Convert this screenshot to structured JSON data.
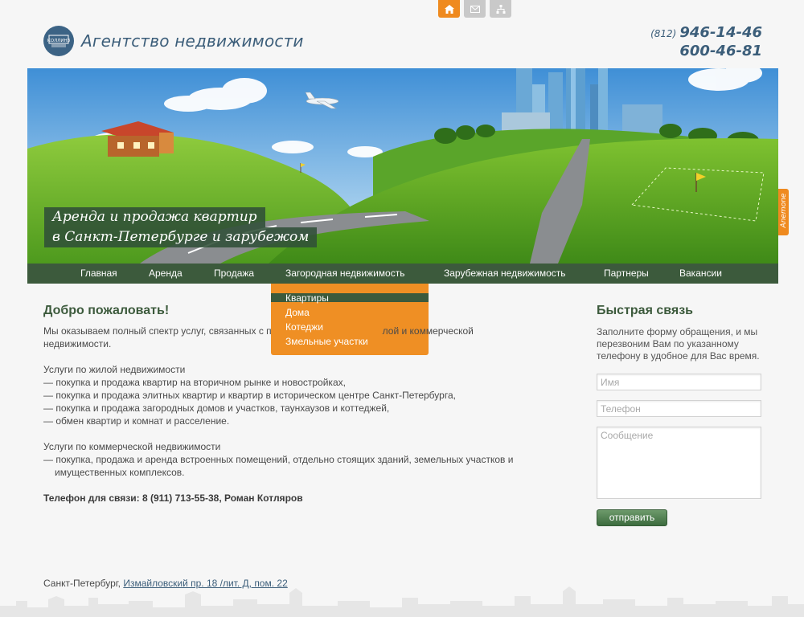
{
  "top_icons": [
    "home-icon",
    "mail-icon",
    "sitemap-icon"
  ],
  "logo": {
    "text": "Агентство недвижимости",
    "mark_text": "КОЛЛИНЗ"
  },
  "phones": {
    "code": "(812)",
    "number1": "946-14-46",
    "number2": "600-46-81"
  },
  "banner": {
    "slogan_line1": "Аренда и продажа квартир",
    "slogan_line2": "в Санкт-Петербурге и зарубежом"
  },
  "side_tab": {
    "label": "Anemone"
  },
  "nav": {
    "items": [
      {
        "label": "Главная"
      },
      {
        "label": "Аренда"
      },
      {
        "label": "Продажа"
      },
      {
        "label": "Загородная недвижимость"
      },
      {
        "label": "Зарубежная недвижимость"
      },
      {
        "label": "Партнеры"
      },
      {
        "label": "Вакансии"
      }
    ]
  },
  "dropdown": {
    "items": [
      {
        "label": "Квартиры"
      },
      {
        "label": "Дома"
      },
      {
        "label": "Котеджи"
      },
      {
        "label": "Змельные участки"
      }
    ]
  },
  "main": {
    "title": "Добро пожаловать!",
    "intro_1": "Мы оказываем полный спектр услуг, связанных с п",
    "intro_2": "лой и коммерческой",
    "intro_3": "недвижимости.",
    "residential_title": "Услуги по жилой недвижимости",
    "residential": [
      "— покупка и продажа квартир на вторичном рынке и новостройках,",
      "— покупка и продажа элитных квартир и квартир в историческом центре Санкт-Петербурга,",
      "— покупка и продажа загородных домов и участков, таунхаузов и коттеджей,",
      "— обмен квартир и комнат и расселение."
    ],
    "commercial_title": "Услуги по коммерческой недвижимости",
    "commercial_1": "— покупка, продажа и аренда встроенных помещений, отдельно стоящих зданий, земельных участков и",
    "commercial_2": "имущественных комплексов.",
    "contact_phone": "Телефон для связи: 8 (911) 713-55-38, Роман Котляров"
  },
  "contact_form": {
    "title": "Быстрая связь",
    "description": "Заполните форму обращения, и мы перезвоним Вам по указанному телефону в удобное для Вас время.",
    "name_placeholder": "Имя",
    "phone_placeholder": "Телефон",
    "message_placeholder": "Сообщение",
    "submit_label": "отправить"
  },
  "footer": {
    "city": "Санкт-Петербург,",
    "address": "Измайловский пр. 18 /лит. Д, пом. 22"
  },
  "colors": {
    "accent": "#ef8a1f",
    "nav": "#3c5a3c",
    "heading": "#3c5a3c",
    "link": "#3c5e7a"
  }
}
